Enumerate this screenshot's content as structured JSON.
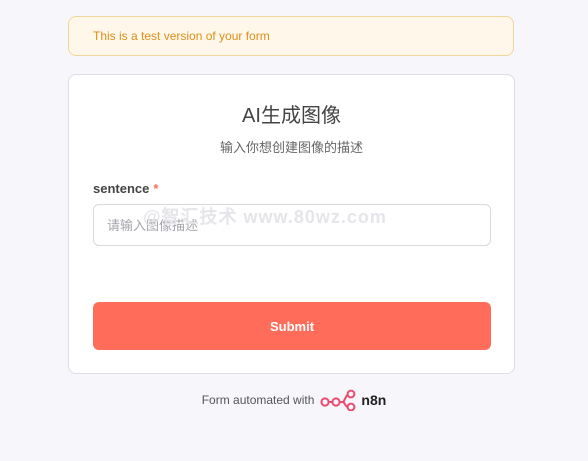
{
  "banner": {
    "text": "This is a test version of your form"
  },
  "form": {
    "title": "AI生成图像",
    "subtitle": "输入你想创建图像的描述",
    "field": {
      "label": "sentence",
      "required_mark": "*",
      "placeholder": "请输入图像描述",
      "value": ""
    },
    "submit_label": "Submit"
  },
  "footer": {
    "text": "Form automated with",
    "brand": "n8n"
  },
  "watermark": "@智汇技术 www.80wz.com",
  "colors": {
    "accent": "#ff6d5a",
    "banner_bg": "#fef7ea",
    "banner_text": "#e08e19"
  }
}
